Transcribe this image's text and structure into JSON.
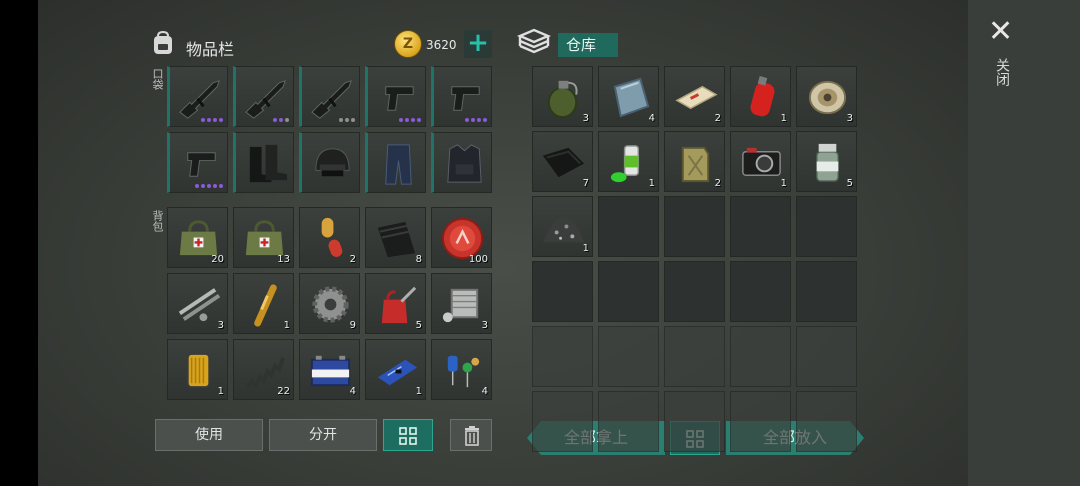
{
  "inventory": {
    "title": "物品栏",
    "coins": "3620",
    "plus": "+",
    "pocket_label": "口袋",
    "backpack_label": "背包",
    "pocket_items": [
      {
        "icon": "rifle-icon",
        "rarity_dots": 4,
        "dot_color": "#8a5ad8",
        "grey_dots": 0
      },
      {
        "icon": "rifle-icon",
        "rarity_dots": 3,
        "dot_color": "#8a5ad8",
        "grey_dots": 1
      },
      {
        "icon": "rifle-icon",
        "rarity_dots": 3,
        "dot_color": "#8f8f8f",
        "grey_dots": 1
      },
      {
        "icon": "pistol-icon",
        "rarity_dots": 4,
        "dot_color": "#8a5ad8",
        "grey_dots": 0
      },
      {
        "icon": "pistol-icon",
        "rarity_dots": 4,
        "dot_color": "#8a5ad8",
        "grey_dots": 0
      },
      {
        "icon": "pistol-icon",
        "rarity_dots": 5,
        "dot_color": "#8a5ad8",
        "grey_dots": 0
      },
      {
        "icon": "boots-icon"
      },
      {
        "icon": "helmet-icon"
      },
      {
        "icon": "pants-icon"
      },
      {
        "icon": "vest-icon"
      }
    ],
    "backpack_items": [
      {
        "icon": "medkit-bag-icon",
        "count": "20"
      },
      {
        "icon": "medkit-bag-icon",
        "count": "13"
      },
      {
        "icon": "capsule-icon",
        "count": "2"
      },
      {
        "icon": "fabric-roll-icon",
        "count": "8"
      },
      {
        "icon": "bottle-cap-icon",
        "count": "100"
      },
      {
        "icon": "metal-pipes-icon",
        "count": "3"
      },
      {
        "icon": "ampoule-icon",
        "count": "1"
      },
      {
        "icon": "gear-icon",
        "count": "9"
      },
      {
        "icon": "oil-can-icon",
        "count": "5"
      },
      {
        "icon": "engine-part-icon",
        "count": "3"
      },
      {
        "icon": "oil-filter-icon",
        "count": "1"
      },
      {
        "icon": "spring-icon",
        "count": "22"
      },
      {
        "icon": "battery-icon",
        "count": "4"
      },
      {
        "icon": "circuit-board-icon",
        "count": "1"
      },
      {
        "icon": "electronic-parts-icon",
        "count": "4"
      }
    ],
    "buttons": {
      "use": "使用",
      "split": "分开"
    }
  },
  "warehouse": {
    "title": "仓库",
    "items": [
      {
        "icon": "grenade-icon",
        "count": "3"
      },
      {
        "icon": "metal-plate-icon",
        "count": "4"
      },
      {
        "icon": "explosive-brick-icon",
        "count": "2"
      },
      {
        "icon": "gas-cylinder-icon",
        "count": "1"
      },
      {
        "icon": "wire-spool-icon",
        "count": "3"
      },
      {
        "icon": "black-cloth-icon",
        "count": "7"
      },
      {
        "icon": "spray-can-icon",
        "count": "1"
      },
      {
        "icon": "jerrycan-icon",
        "count": "2"
      },
      {
        "icon": "camera-icon",
        "count": "1"
      },
      {
        "icon": "jar-icon",
        "count": "5"
      },
      {
        "icon": "gravel-pile-icon",
        "count": "1"
      }
    ],
    "buttons": {
      "take_all": "全部拿上",
      "put_all": "全部放入"
    }
  },
  "close": {
    "icon": "close-icon",
    "label": "关闭"
  },
  "colors": {
    "accent": "#1f6a5c",
    "teal_button": "#2a7f70",
    "rarity_purple": "#8a5ad8"
  }
}
